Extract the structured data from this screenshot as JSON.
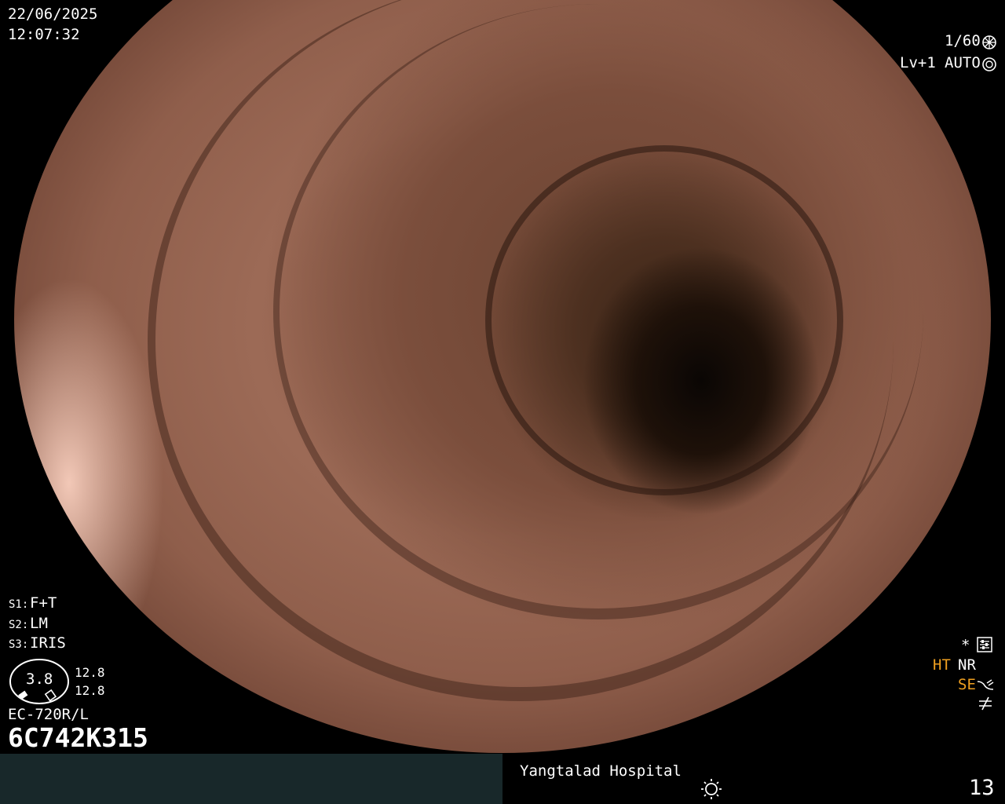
{
  "header": {
    "date": "22/06/2025",
    "time": "12:07:32",
    "shutter": "1/60",
    "level": "Lv+1",
    "mode": "AUTO"
  },
  "settings": {
    "s1_label": "S1:",
    "s1_value": "F+T",
    "s2_label": "S2:",
    "s2_value": "LM",
    "s3_label": "S3:",
    "s3_value": "IRIS"
  },
  "gauge": {
    "value": "3.8",
    "upper": "12.8",
    "lower": "12.8"
  },
  "device": {
    "model": "EC-720R/L",
    "serial": "6C742K315"
  },
  "status": {
    "asterisk": "*",
    "ht": "HT",
    "nr": "NR",
    "se": "SE",
    "ht_color": "#f0a020",
    "se_color": "#f0a020"
  },
  "footer": {
    "hospital": "Yangtalad Hospital",
    "count": "13"
  }
}
